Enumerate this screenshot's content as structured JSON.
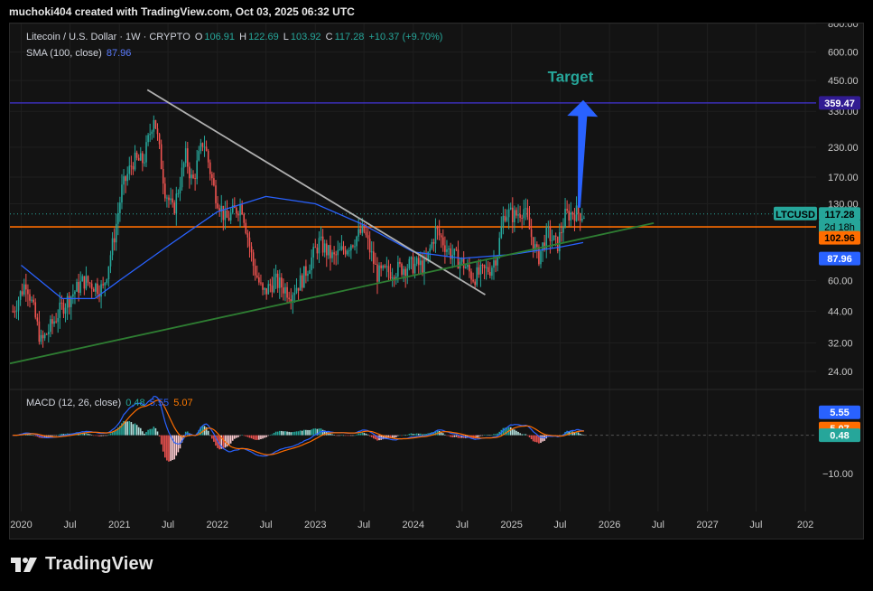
{
  "header": {
    "credit": "muchoki404 created with TradingView.com, Oct 03, 2025 06:32 UTC"
  },
  "legend": {
    "symbol": "Litecoin / U.S. Dollar · 1W · CRYPTO",
    "o_label": "O",
    "o_value": "106.91",
    "h_label": "H",
    "h_value": "122.69",
    "l_label": "L",
    "l_value": "103.92",
    "c_label": "C",
    "c_value": "117.28",
    "change": "+10.37 (+9.70%)",
    "sma_label": "SMA (100, close)",
    "sma_value": "87.96"
  },
  "macd_legend": {
    "label": "MACD (12, 26, close)",
    "histogram": "0.48",
    "macd": "5.55",
    "signal": "5.07"
  },
  "annotation": {
    "target_text": "Target"
  },
  "colors": {
    "up": "#26a69a",
    "down": "#ef5350",
    "sma": "#2962ff",
    "resistance_line": "#3c2fb8",
    "support_orange": "#ff6d00",
    "trend_down": "#b0b0b0",
    "trend_up": "#2e7d32",
    "target_arrow": "#2962ff",
    "target_text": "#26a69a"
  },
  "footer": {
    "brand": "TradingView",
    "logo_icon": "tradingview-logo-icon"
  },
  "chart_data": {
    "type": "candlestick",
    "title": "Litecoin / U.S. Dollar · 1W · CRYPTO",
    "y_scale": "log",
    "ylim": [
      20,
      800
    ],
    "price_ticks": [
      "800.00",
      "600.00",
      "450.00",
      "330.00",
      "230.00",
      "170.00",
      "130.00",
      "60.00",
      "44.00",
      "32.00",
      "24.00"
    ],
    "x_tick_labels": [
      "2020",
      "Jul",
      "2021",
      "Jul",
      "2022",
      "Jul",
      "2023",
      "Jul",
      "2024",
      "Jul",
      "2025",
      "Jul",
      "2026",
      "Jul",
      "2027",
      "Jul",
      "202"
    ],
    "x_tick_dates": [
      "2020-01-01",
      "2020-07-01",
      "2021-01-01",
      "2021-07-01",
      "2022-01-01",
      "2022-07-01",
      "2023-01-01",
      "2023-07-01",
      "2024-01-01",
      "2024-07-01",
      "2025-01-01",
      "2025-07-01",
      "2026-01-01",
      "2026-07-01",
      "2027-01-01",
      "2027-07-01",
      "2028-01-01"
    ],
    "x_range": [
      "2019-11-20",
      "2028-02-10"
    ],
    "price_anchors": [
      [
        "2019-12-01",
        44
      ],
      [
        "2020-01-20",
        60
      ],
      [
        "2020-03-16",
        32
      ],
      [
        "2020-06-01",
        46
      ],
      [
        "2020-08-20",
        60
      ],
      [
        "2020-11-01",
        55
      ],
      [
        "2020-12-10",
        90
      ],
      [
        "2021-01-10",
        150
      ],
      [
        "2021-02-20",
        200
      ],
      [
        "2021-04-01",
        200
      ],
      [
        "2021-05-10",
        320
      ],
      [
        "2021-06-20",
        150
      ],
      [
        "2021-07-20",
        120
      ],
      [
        "2021-09-05",
        210
      ],
      [
        "2021-09-30",
        160
      ],
      [
        "2021-11-10",
        250
      ],
      [
        "2021-12-20",
        150
      ],
      [
        "2022-02-01",
        110
      ],
      [
        "2022-04-01",
        130
      ],
      [
        "2022-05-15",
        70
      ],
      [
        "2022-06-20",
        52
      ],
      [
        "2022-08-01",
        60
      ],
      [
        "2022-10-01",
        53
      ],
      [
        "2022-11-10",
        60
      ],
      [
        "2023-01-15",
        88
      ],
      [
        "2023-03-10",
        75
      ],
      [
        "2023-05-01",
        85
      ],
      [
        "2023-06-30",
        100
      ],
      [
        "2023-08-20",
        64
      ],
      [
        "2023-10-10",
        66
      ],
      [
        "2023-12-20",
        70
      ],
      [
        "2024-02-15",
        70
      ],
      [
        "2024-03-25",
        100
      ],
      [
        "2024-05-15",
        80
      ],
      [
        "2024-07-10",
        70
      ],
      [
        "2024-08-10",
        62
      ],
      [
        "2024-10-15",
        68
      ],
      [
        "2024-11-10",
        80
      ],
      [
        "2024-12-05",
        120
      ],
      [
        "2025-01-15",
        115
      ],
      [
        "2025-02-15",
        125
      ],
      [
        "2025-03-20",
        90
      ],
      [
        "2025-04-10",
        75
      ],
      [
        "2025-05-15",
        97
      ],
      [
        "2025-06-20",
        85
      ],
      [
        "2025-07-20",
        115
      ],
      [
        "2025-08-20",
        120
      ],
      [
        "2025-09-25",
        117
      ]
    ],
    "sma_100_anchors": [
      [
        "2020-01-01",
        70
      ],
      [
        "2020-06-01",
        50
      ],
      [
        "2020-10-01",
        50
      ],
      [
        "2021-01-01",
        60
      ],
      [
        "2021-07-01",
        85
      ],
      [
        "2022-01-01",
        120
      ],
      [
        "2022-07-01",
        140
      ],
      [
        "2023-01-01",
        130
      ],
      [
        "2023-07-01",
        105
      ],
      [
        "2024-01-01",
        80
      ],
      [
        "2024-07-01",
        75
      ],
      [
        "2025-01-01",
        78
      ],
      [
        "2025-07-01",
        84
      ],
      [
        "2025-09-25",
        87.96
      ]
    ],
    "resistance_level": 359.47,
    "support_level": 102.96,
    "last_price": 117.28,
    "sma_last": 87.96,
    "countdown_label": "2d 18h",
    "symbol_tag": "LTCUSD",
    "descending_trendline": [
      [
        "2021-04-15",
        410
      ],
      [
        "2024-09-25",
        52
      ]
    ],
    "ascending_trendline": [
      [
        "2019-11-20",
        26
      ],
      [
        "2026-06-15",
        107
      ]
    ],
    "target_arrow": [
      [
        "2025-09-10",
        125
      ],
      [
        "2025-09-25",
        370
      ]
    ],
    "macd": {
      "ticks": [
        "5.55",
        "5.07",
        "0.48",
        "−10.00"
      ],
      "tick_values": [
        5.55,
        5.07,
        0.48,
        -10
      ],
      "ylim": [
        -20,
        12
      ],
      "histogram_last": 0.48,
      "macd_last": 5.55,
      "signal_last": 5.07
    }
  }
}
